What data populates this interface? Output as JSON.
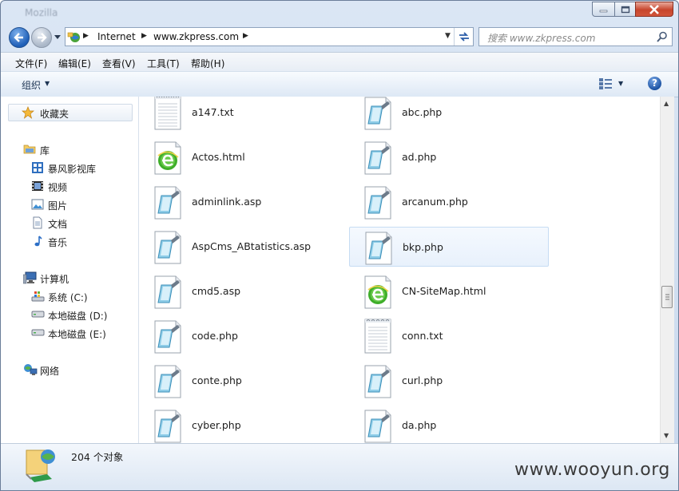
{
  "window": {
    "title": "Mozilla",
    "controls": {
      "minimize": "minimize-icon",
      "maximize": "maximize-icon",
      "close": "close-icon"
    }
  },
  "address": {
    "crumbs": [
      "Internet",
      "www.zkpress.com"
    ]
  },
  "search": {
    "placeholder": "搜索 www.zkpress.com"
  },
  "menu": [
    "文件(F)",
    "编辑(E)",
    "查看(V)",
    "工具(T)",
    "帮助(H)"
  ],
  "toolbar": {
    "organize_label": "组织"
  },
  "sidebar": {
    "favorites": "收藏夹",
    "libraries": {
      "label": "库",
      "items": [
        "暴风影视库",
        "视频",
        "图片",
        "文档",
        "音乐"
      ]
    },
    "computer": {
      "label": "计算机",
      "items": [
        "系统 (C:)",
        "本地磁盘 (D:)",
        "本地磁盘 (E:)"
      ]
    },
    "network": "网络"
  },
  "files": [
    {
      "name": "a147.txt",
      "type": "txt"
    },
    {
      "name": "abc.php",
      "type": "script"
    },
    {
      "name": "Actos.html",
      "type": "html"
    },
    {
      "name": "ad.php",
      "type": "script"
    },
    {
      "name": "adminlink.asp",
      "type": "script"
    },
    {
      "name": "arcanum.php",
      "type": "script"
    },
    {
      "name": "AspCms_ABtatistics.asp",
      "type": "script"
    },
    {
      "name": "bkp.php",
      "type": "script",
      "selected": true
    },
    {
      "name": "cmd5.asp",
      "type": "script"
    },
    {
      "name": "CN-SiteMap.html",
      "type": "html"
    },
    {
      "name": "code.php",
      "type": "script"
    },
    {
      "name": "conn.txt",
      "type": "txt"
    },
    {
      "name": "conte.php",
      "type": "script"
    },
    {
      "name": "curl.php",
      "type": "script"
    },
    {
      "name": "cyber.php",
      "type": "script"
    },
    {
      "name": "da.php",
      "type": "script"
    }
  ],
  "status": {
    "count_text": "204 个对象"
  },
  "watermark": "www.wooyun.org"
}
